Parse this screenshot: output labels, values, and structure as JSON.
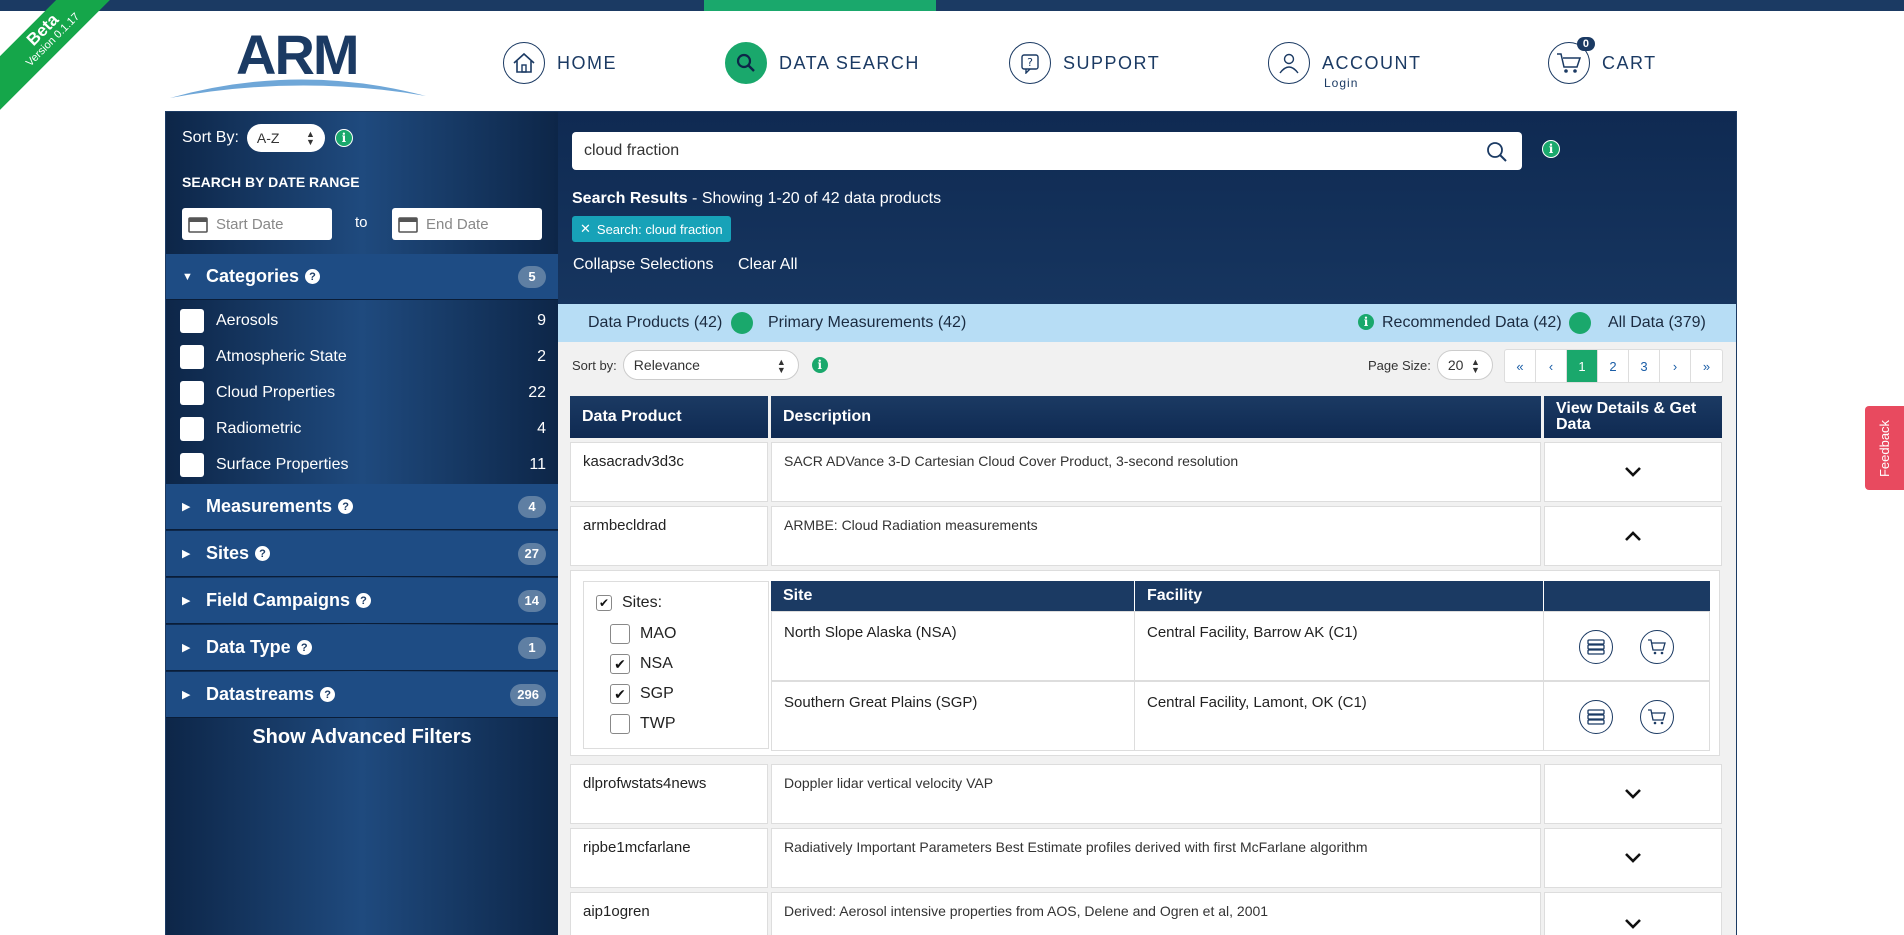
{
  "beta": {
    "label": "Beta",
    "version": "Version 0.1.17"
  },
  "logo": {
    "text": "ARM"
  },
  "nav": {
    "home": "HOME",
    "data_search": "DATA SEARCH",
    "support": "SUPPORT",
    "account": "ACCOUNT",
    "account_sub": "Login",
    "cart": "CART",
    "cart_count": "0"
  },
  "sidebar": {
    "sort_label": "Sort By:",
    "sort_value": "A-Z",
    "date_range_label": "SEARCH BY DATE RANGE",
    "start_placeholder": "Start Date",
    "to_label": "to",
    "end_placeholder": "End Date",
    "categories": {
      "label": "Categories",
      "count": "5"
    },
    "category_items": [
      {
        "label": "Aerosols",
        "count": "9"
      },
      {
        "label": "Atmospheric State",
        "count": "2"
      },
      {
        "label": "Cloud Properties",
        "count": "22"
      },
      {
        "label": "Radiometric",
        "count": "4"
      },
      {
        "label": "Surface Properties",
        "count": "11"
      }
    ],
    "sections": [
      {
        "label": "Measurements",
        "count": "4"
      },
      {
        "label": "Sites",
        "count": "27"
      },
      {
        "label": "Field Campaigns",
        "count": "14"
      },
      {
        "label": "Data Type",
        "count": "1"
      },
      {
        "label": "Datastreams",
        "count": "296"
      }
    ],
    "advanced_filters": "Show Advanced Filters"
  },
  "search": {
    "query": "cloud fraction",
    "results_label": "Search Results",
    "results_text": " - Showing 1-20 of 42 data products",
    "chip": "Search: cloud fraction",
    "collapse": "Collapse Selections",
    "clear_all": "Clear All"
  },
  "toggles": {
    "data_products": "Data Products (42)",
    "primary_measurements": "Primary Measurements (42)",
    "recommended": "Recommended Data (42)",
    "all_data": "All Data (379)"
  },
  "controls": {
    "sort_label": "Sort by:",
    "sort_value": "Relevance",
    "page_size_label": "Page Size:",
    "page_size": "20",
    "pages": [
      "«",
      "‹",
      "1",
      "2",
      "3",
      "›",
      "»"
    ]
  },
  "table": {
    "headers": [
      "Data Product",
      "Description",
      "View Details & Get Data"
    ],
    "rows": [
      {
        "product": "kasacradv3d3c",
        "description": "SACR ADVance 3-D Cartesian Cloud Cover Product, 3-second resolution",
        "expanded": false
      },
      {
        "product": "armbecldrad",
        "description": "ARMBE: Cloud Radiation measurements",
        "expanded": true
      },
      {
        "product": "dlprofwstats4news",
        "description": "Doppler lidar vertical velocity VAP",
        "expanded": false
      },
      {
        "product": "ripbe1mcfarlane",
        "description": "Radiatively Important Parameters Best Estimate profiles derived with first McFarlane algorithm",
        "expanded": false
      },
      {
        "product": "aip1ogren",
        "description": "Derived: Aerosol intensive properties from AOS, Delene and Ogren et al, 2001",
        "expanded": false
      }
    ]
  },
  "expanded": {
    "sites_label": "Sites:",
    "site_options": [
      {
        "label": "MAO",
        "checked": false
      },
      {
        "label": "NSA",
        "checked": true
      },
      {
        "label": "SGP",
        "checked": true
      },
      {
        "label": "TWP",
        "checked": false
      }
    ],
    "headers": [
      "Site",
      "Facility"
    ],
    "rows": [
      {
        "site": "North Slope Alaska (NSA)",
        "facility": "Central Facility, Barrow AK (C1)"
      },
      {
        "site": "Southern Great Plains (SGP)",
        "facility": "Central Facility, Lamont, OK (C1)"
      }
    ]
  },
  "feedback": "Feedback",
  "colors": {
    "brand_navy": "#1b3a63",
    "accent_green": "#1aa86c",
    "chip_teal": "#17a2b8",
    "toggle_bar": "#b7ddf5",
    "feedback_red": "#e84a5f"
  }
}
